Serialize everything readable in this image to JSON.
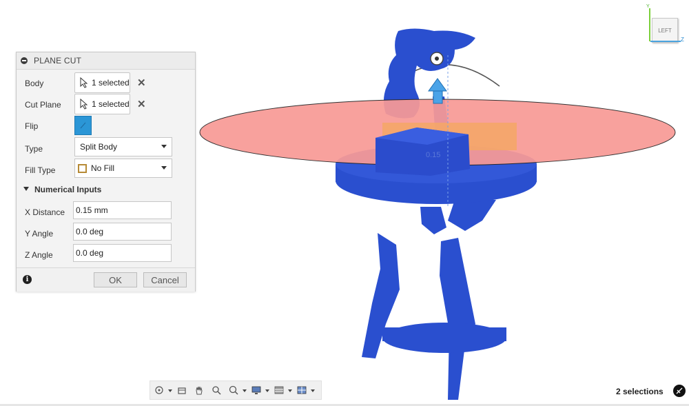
{
  "viewcube": {
    "face_label": "LEFT",
    "axis_y": "Y",
    "axis_z": "Z"
  },
  "dialog": {
    "title": "PLANE CUT",
    "body": {
      "label": "Body",
      "value": "1 selected"
    },
    "cut_plane": {
      "label": "Cut Plane",
      "value": "1 selected"
    },
    "flip": {
      "label": "Flip"
    },
    "type": {
      "label": "Type",
      "value": "Split Body"
    },
    "fill_type": {
      "label": "Fill Type",
      "value": "No Fill"
    },
    "numerical_inputs": {
      "label": "Numerical Inputs",
      "x_distance": {
        "label": "X Distance",
        "value": "0.15 mm"
      },
      "y_angle": {
        "label": "Y Angle",
        "value": "0.0 deg"
      },
      "z_angle": {
        "label": "Z Angle",
        "value": "0.0 deg"
      }
    },
    "ok_label": "OK",
    "cancel_label": "Cancel"
  },
  "viewport": {
    "plane_color": "#f89a96",
    "model_color": "#2a4fcf",
    "gizmo_color": "#3f8fd8",
    "measure_label": "0.15"
  },
  "toolbar": {
    "items": [
      "orbit-icon",
      "look-at-icon",
      "pan-icon",
      "zoom-icon",
      "fit-icon",
      "display-settings-icon",
      "grid-settings-icon",
      "viewports-icon"
    ]
  },
  "status": {
    "selections": "2 selections"
  }
}
